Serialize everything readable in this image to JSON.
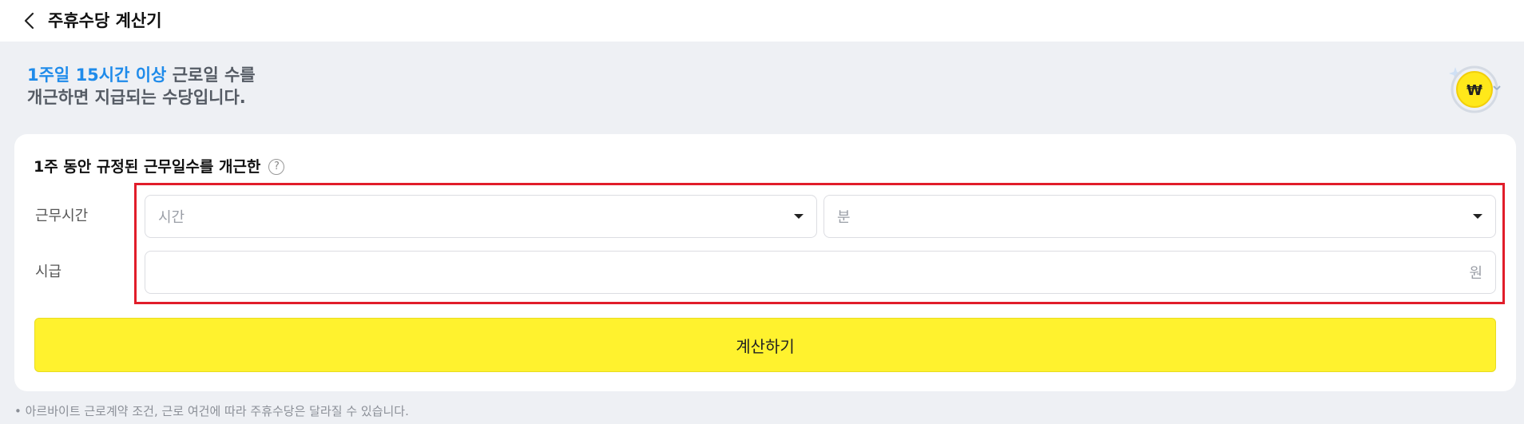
{
  "header": {
    "back_label": "뒤로",
    "title": "주휴수당 계산기"
  },
  "intro": {
    "highlight": "1주일 15시간 이상",
    "line1_rest": " 근로일 수를",
    "line2": "개근하면 지급되는 수당입니다."
  },
  "coin": {
    "symbol": "₩",
    "color": "#ffe81a"
  },
  "form": {
    "section_title": "1주 동안 규정된 근무일수를 개근한",
    "help_icon": "?",
    "work_time_label": "근무시간",
    "hours_placeholder": "시간",
    "minutes_placeholder": "분",
    "wage_label": "시급",
    "wage_value": "",
    "wage_unit": "원"
  },
  "actions": {
    "calculate_label": "계산하기"
  },
  "footnote": "• 아르바이트 근로계약 조건, 근로 여건에 따라 주휴수당은 달라질 수 있습니다.",
  "colors": {
    "accent_blue": "#1f8bea",
    "button_yellow": "#fff22e",
    "highlight_red": "#e11d2a",
    "background": "#eef0f4"
  }
}
